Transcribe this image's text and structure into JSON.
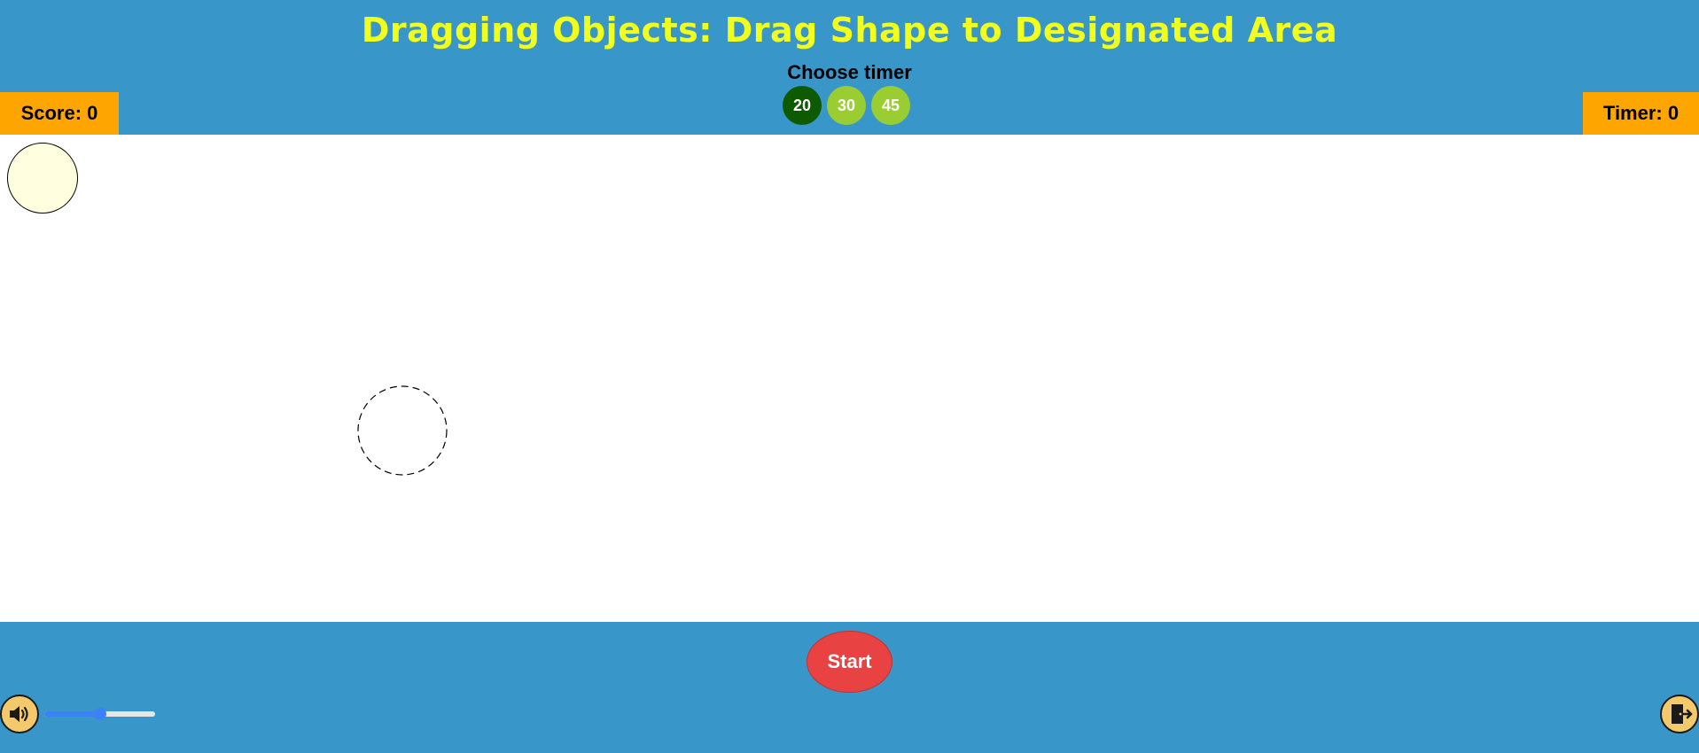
{
  "header": {
    "title": "Dragging Objects: Drag Shape to Designated Area",
    "choose_timer_label": "Choose timer",
    "timer_options": [
      {
        "label": "20",
        "selected": true
      },
      {
        "label": "30",
        "selected": false
      },
      {
        "label": "45",
        "selected": false
      }
    ],
    "score_text": "Score: 0",
    "timer_text": "Timer: 0"
  },
  "game": {
    "shape": "circle",
    "target_shape": "circle"
  },
  "footer": {
    "start_label": "Start",
    "volume_level": 0.5
  },
  "colors": {
    "background": "#3996c8",
    "title": "#f2ff1c",
    "badge": "#ffa500",
    "timer_option": "#9acd32",
    "timer_option_selected": "#0d5a00",
    "start_button": "#e94242",
    "shape_fill": "#ffffe0",
    "icon_button": "#f3c96b",
    "slider": "#3b82f6"
  },
  "icons": {
    "sound": "speaker-icon",
    "exit": "exit-door-icon"
  }
}
